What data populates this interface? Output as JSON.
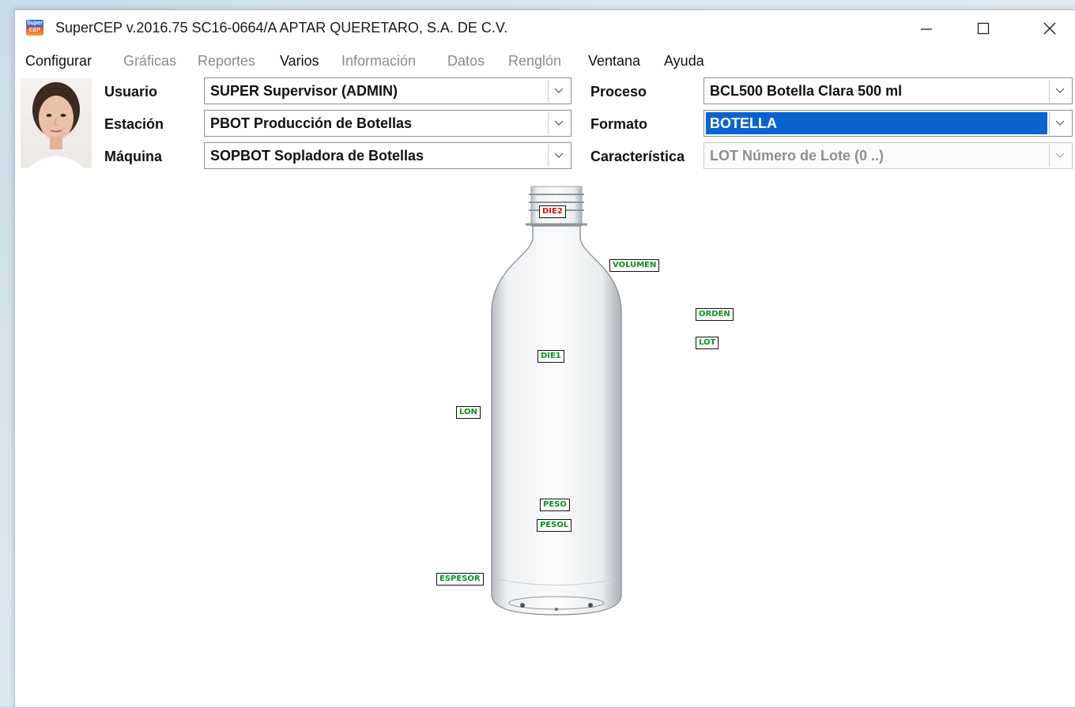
{
  "window": {
    "title": "SuperCEP v.2016.75  SC16-0664/A  APTAR QUERETARO, S.A. DE C.V.",
    "icon_text_top": "Super",
    "icon_text_bottom": "CEP",
    "controls": [
      "minimize-icon",
      "maximize-icon",
      "close-icon"
    ]
  },
  "menu": [
    {
      "label": "Configurar",
      "enabled": true
    },
    {
      "label": "Gráficas",
      "enabled": false
    },
    {
      "label": "Reportes",
      "enabled": false
    },
    {
      "label": "Varios",
      "enabled": true
    },
    {
      "label": "Información",
      "enabled": false
    },
    {
      "label": "Datos",
      "enabled": false
    },
    {
      "label": "Renglón",
      "enabled": false
    },
    {
      "label": "Ventana",
      "enabled": true
    },
    {
      "label": "Ayuda",
      "enabled": true
    }
  ],
  "form": {
    "usuario_label": "Usuario",
    "usuario_value": "SUPER  Supervisor (ADMIN)",
    "estacion_label": "Estación",
    "estacion_value": "PBOT  Producción de Botellas",
    "maquina_label": "Máquina",
    "maquina_value": "SOPBOT  Sopladora de Botellas",
    "proceso_label": "Proceso",
    "proceso_value": "BCL500  Botella Clara 500 ml",
    "formato_label": "Formato",
    "formato_value": "BOTELLA",
    "caracteristica_label": "Característica",
    "caracteristica_value": "LOT  Número de Lote (0 ..)"
  },
  "characteristic_tags": [
    {
      "text": "DIE2",
      "color": "#e01010"
    },
    {
      "text": "VOLUMEN",
      "color": "#0a8f22"
    },
    {
      "text": "ORDEN",
      "color": "#0a8f22"
    },
    {
      "text": "LOT",
      "color": "#0a8f22"
    },
    {
      "text": "DIE1",
      "color": "#0a8f22"
    },
    {
      "text": "LON",
      "color": "#0a8f22"
    },
    {
      "text": "PESO",
      "color": "#0a8f22"
    },
    {
      "text": "PESOL",
      "color": "#0a8f22"
    },
    {
      "text": "ESPESOR",
      "color": "#0a8f22"
    }
  ],
  "colors": {
    "selection": "#0a64cf",
    "tag_ok": "#0a8f22",
    "tag_alert": "#e01010"
  }
}
